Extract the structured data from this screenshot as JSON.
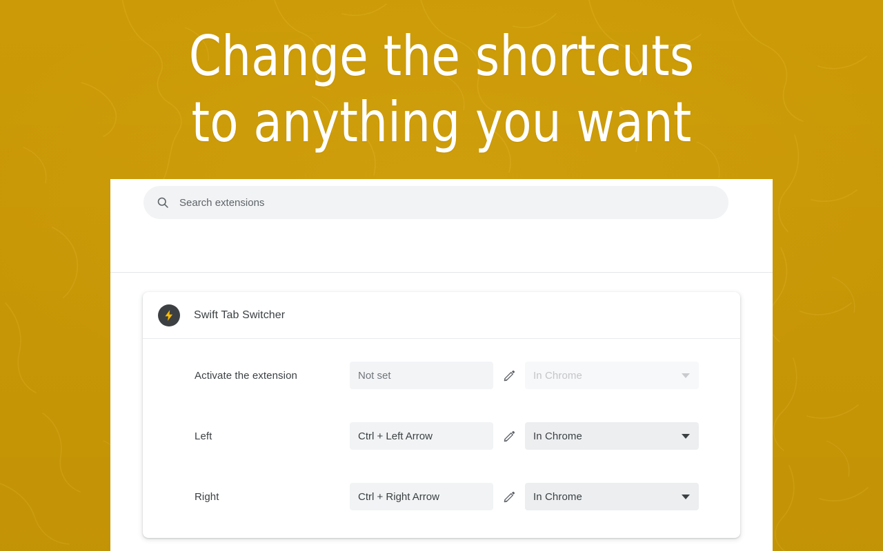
{
  "promo": {
    "headline_line1": "Change the shortcuts",
    "headline_line2": "to anything you want",
    "background_color": "#cc9a06",
    "headline_color": "#ffffff"
  },
  "search": {
    "placeholder": "Search extensions",
    "value": "",
    "icon": "search-icon"
  },
  "extension": {
    "name": "Swift Tab Switcher",
    "icon": "lightning-bolt-icon",
    "icon_color": "#fbbc04",
    "avatar_color": "#3c4043"
  },
  "shortcuts": {
    "rows": [
      {
        "label": "Activate the extension",
        "shortcut": "Not set",
        "is_set": false,
        "edit_icon": "pencil-icon",
        "scope": "In Chrome",
        "scope_enabled": false
      },
      {
        "label": "Left",
        "shortcut": "Ctrl + Left Arrow",
        "is_set": true,
        "edit_icon": "pencil-icon",
        "scope": "In Chrome",
        "scope_enabled": true
      },
      {
        "label": "Right",
        "shortcut": "Ctrl + Right Arrow",
        "is_set": true,
        "edit_icon": "pencil-icon",
        "scope": "In Chrome",
        "scope_enabled": true
      }
    ]
  }
}
